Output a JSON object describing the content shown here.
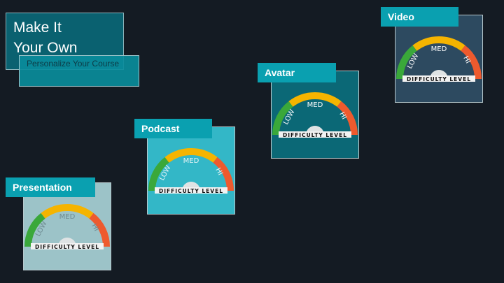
{
  "header": {
    "title_line1": "Make It",
    "title_line2": "Your Own",
    "subtitle": "Personalize Your Course"
  },
  "gauge": {
    "low": "LOW",
    "med": "MED",
    "hi": "HI",
    "caption": "DIFFICULTY LEVEL",
    "colors": {
      "low": "#3aa83a",
      "med": "#f5b400",
      "hi": "#ee5a2e"
    }
  },
  "cards": [
    {
      "label": "Presentation",
      "bg": "#9cc3c8",
      "text_color": "#6e8a90"
    },
    {
      "label": "Podcast",
      "bg": "#33b7c7",
      "text_color": "#e8f4f6"
    },
    {
      "label": "Avatar",
      "bg": "#0b6876",
      "text_color": "#ffffff"
    },
    {
      "label": "Video",
      "bg": "#2d4a60",
      "text_color": "#ffffff"
    }
  ]
}
